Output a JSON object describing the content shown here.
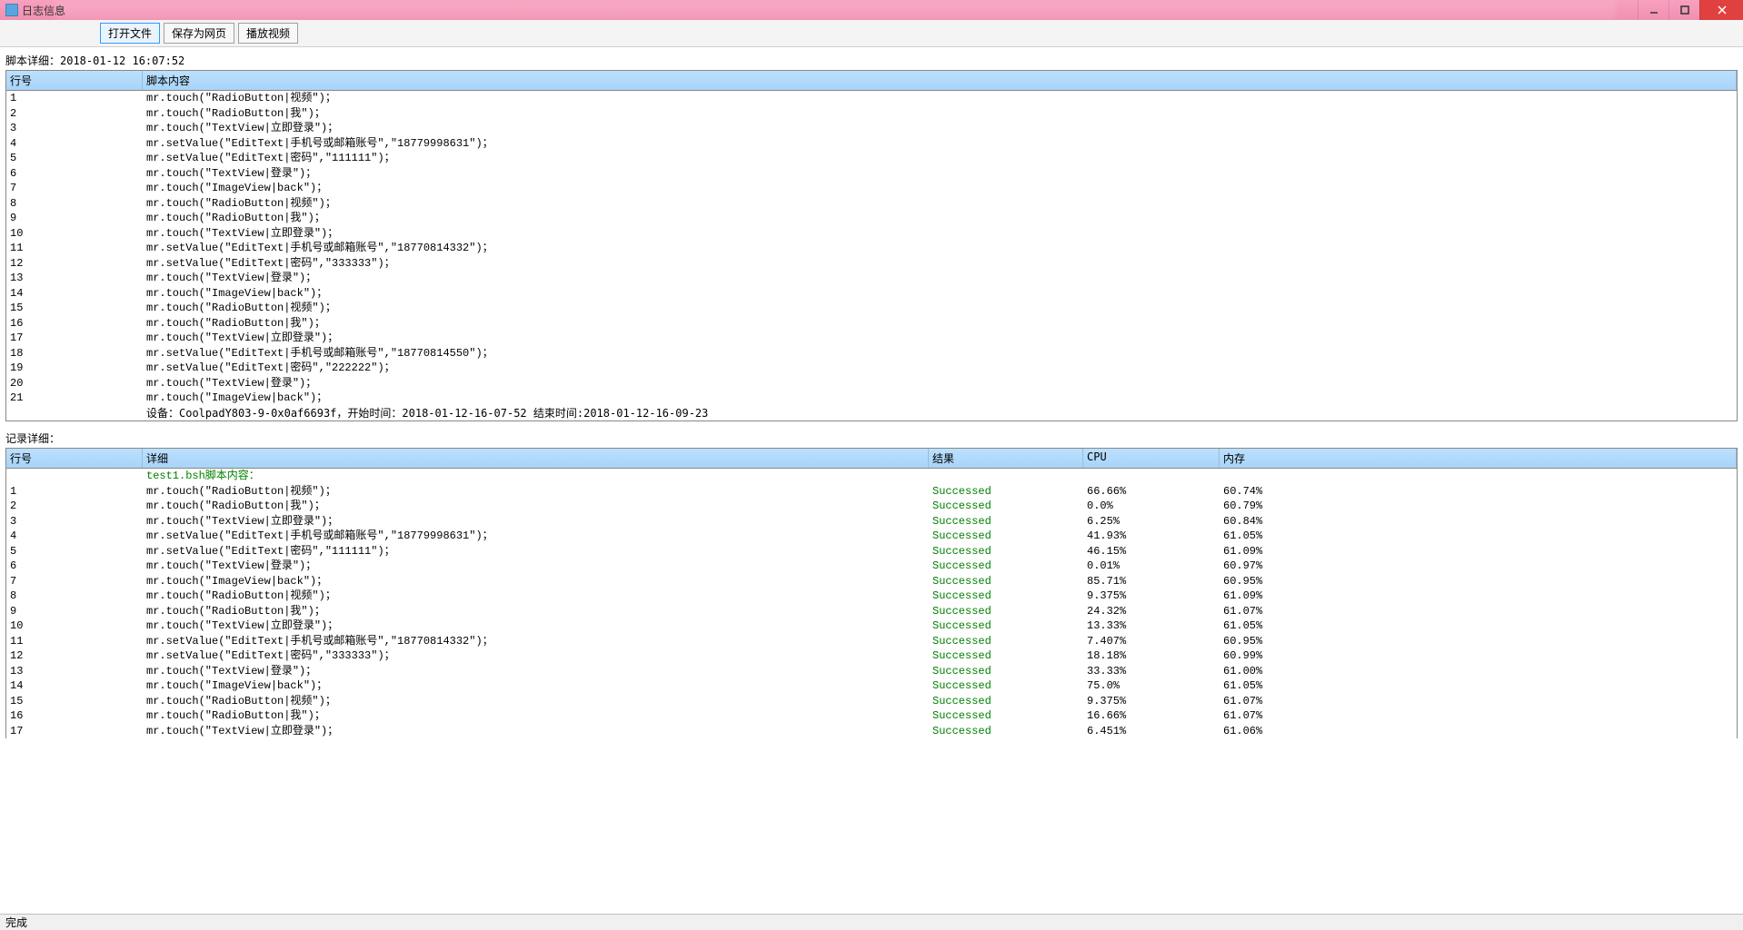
{
  "window": {
    "title": "日志信息",
    "status": "完成"
  },
  "toolbar": {
    "open_file": "打开文件",
    "save_as_web": "保存为网页",
    "play_video": "播放视频"
  },
  "script_section": {
    "label": "脚本详细：2018-01-12 16:07:52",
    "col_line": "行号",
    "col_content": "脚本内容",
    "rows": [
      {
        "n": "1",
        "c": "mr.touch(\"RadioButton|视频\")；"
      },
      {
        "n": "2",
        "c": "mr.touch(\"RadioButton|我\")；"
      },
      {
        "n": "3",
        "c": "mr.touch(\"TextView|立即登录\")；"
      },
      {
        "n": "4",
        "c": "mr.setValue(\"EditText|手机号或邮箱账号\",\"18779998631\")；"
      },
      {
        "n": "5",
        "c": "mr.setValue(\"EditText|密码\",\"111111\")；"
      },
      {
        "n": "6",
        "c": "mr.touch(\"TextView|登录\")；"
      },
      {
        "n": "7",
        "c": "mr.touch(\"ImageView|back\")；"
      },
      {
        "n": "8",
        "c": "mr.touch(\"RadioButton|视频\")；"
      },
      {
        "n": "9",
        "c": "mr.touch(\"RadioButton|我\")；"
      },
      {
        "n": "10",
        "c": "mr.touch(\"TextView|立即登录\")；"
      },
      {
        "n": "11",
        "c": "mr.setValue(\"EditText|手机号或邮箱账号\",\"18770814332\")；"
      },
      {
        "n": "12",
        "c": "mr.setValue(\"EditText|密码\",\"333333\")；"
      },
      {
        "n": "13",
        "c": "mr.touch(\"TextView|登录\")；"
      },
      {
        "n": "14",
        "c": "mr.touch(\"ImageView|back\")；"
      },
      {
        "n": "15",
        "c": "mr.touch(\"RadioButton|视频\")；"
      },
      {
        "n": "16",
        "c": "mr.touch(\"RadioButton|我\")；"
      },
      {
        "n": "17",
        "c": "mr.touch(\"TextView|立即登录\")；"
      },
      {
        "n": "18",
        "c": "mr.setValue(\"EditText|手机号或邮箱账号\",\"18770814550\")；"
      },
      {
        "n": "19",
        "c": "mr.setValue(\"EditText|密码\",\"222222\")；"
      },
      {
        "n": "20",
        "c": "mr.touch(\"TextView|登录\")；"
      },
      {
        "n": "21",
        "c": "mr.touch(\"ImageView|back\")；"
      }
    ],
    "footer": "设备：CoolpadY803-9-0x0af6693f，开始时间：2018-01-12-16-07-52 结束时间:2018-01-12-16-09-23"
  },
  "record_section": {
    "label": "记录详细：",
    "col_line": "行号",
    "col_detail": "详细",
    "col_result": "结果",
    "col_cpu": "CPU",
    "col_mem": "内存",
    "header_row": "test1.bsh脚本内容：",
    "rows": [
      {
        "n": "1",
        "c": "mr.touch(\"RadioButton|视频\")；",
        "r": "Successed",
        "cpu": "66.66%",
        "mem": "60.74%"
      },
      {
        "n": "2",
        "c": "mr.touch(\"RadioButton|我\")；",
        "r": "Successed",
        "cpu": "0.0%",
        "mem": "60.79%"
      },
      {
        "n": "3",
        "c": "mr.touch(\"TextView|立即登录\")；",
        "r": "Successed",
        "cpu": "6.25%",
        "mem": "60.84%"
      },
      {
        "n": "4",
        "c": "mr.setValue(\"EditText|手机号或邮箱账号\",\"18779998631\")；",
        "r": "Successed",
        "cpu": "41.93%",
        "mem": "61.05%"
      },
      {
        "n": "5",
        "c": "mr.setValue(\"EditText|密码\",\"111111\")；",
        "r": "Successed",
        "cpu": "46.15%",
        "mem": "61.09%"
      },
      {
        "n": "6",
        "c": "mr.touch(\"TextView|登录\")；",
        "r": "Successed",
        "cpu": "0.01%",
        "mem": "60.97%"
      },
      {
        "n": "7",
        "c": "mr.touch(\"ImageView|back\")；",
        "r": "Successed",
        "cpu": "85.71%",
        "mem": "60.95%"
      },
      {
        "n": "8",
        "c": "mr.touch(\"RadioButton|视频\")；",
        "r": "Successed",
        "cpu": "9.375%",
        "mem": "61.09%"
      },
      {
        "n": "9",
        "c": "mr.touch(\"RadioButton|我\")；",
        "r": "Successed",
        "cpu": "24.32%",
        "mem": "61.07%"
      },
      {
        "n": "10",
        "c": "mr.touch(\"TextView|立即登录\")；",
        "r": "Successed",
        "cpu": "13.33%",
        "mem": "61.05%"
      },
      {
        "n": "11",
        "c": "mr.setValue(\"EditText|手机号或邮箱账号\",\"18770814332\")；",
        "r": "Successed",
        "cpu": "7.407%",
        "mem": "60.95%"
      },
      {
        "n": "12",
        "c": "mr.setValue(\"EditText|密码\",\"333333\")；",
        "r": "Successed",
        "cpu": "18.18%",
        "mem": "60.99%"
      },
      {
        "n": "13",
        "c": "mr.touch(\"TextView|登录\")；",
        "r": "Successed",
        "cpu": "33.33%",
        "mem": "61.00%"
      },
      {
        "n": "14",
        "c": "mr.touch(\"ImageView|back\")；",
        "r": "Successed",
        "cpu": "75.0%",
        "mem": "61.05%"
      },
      {
        "n": "15",
        "c": "mr.touch(\"RadioButton|视频\")；",
        "r": "Successed",
        "cpu": "9.375%",
        "mem": "61.07%"
      },
      {
        "n": "16",
        "c": "mr.touch(\"RadioButton|我\")；",
        "r": "Successed",
        "cpu": "16.66%",
        "mem": "61.07%"
      },
      {
        "n": "17",
        "c": "mr.touch(\"TextView|立即登录\")；",
        "r": "Successed",
        "cpu": "6.451%",
        "mem": "61.06%"
      }
    ]
  }
}
